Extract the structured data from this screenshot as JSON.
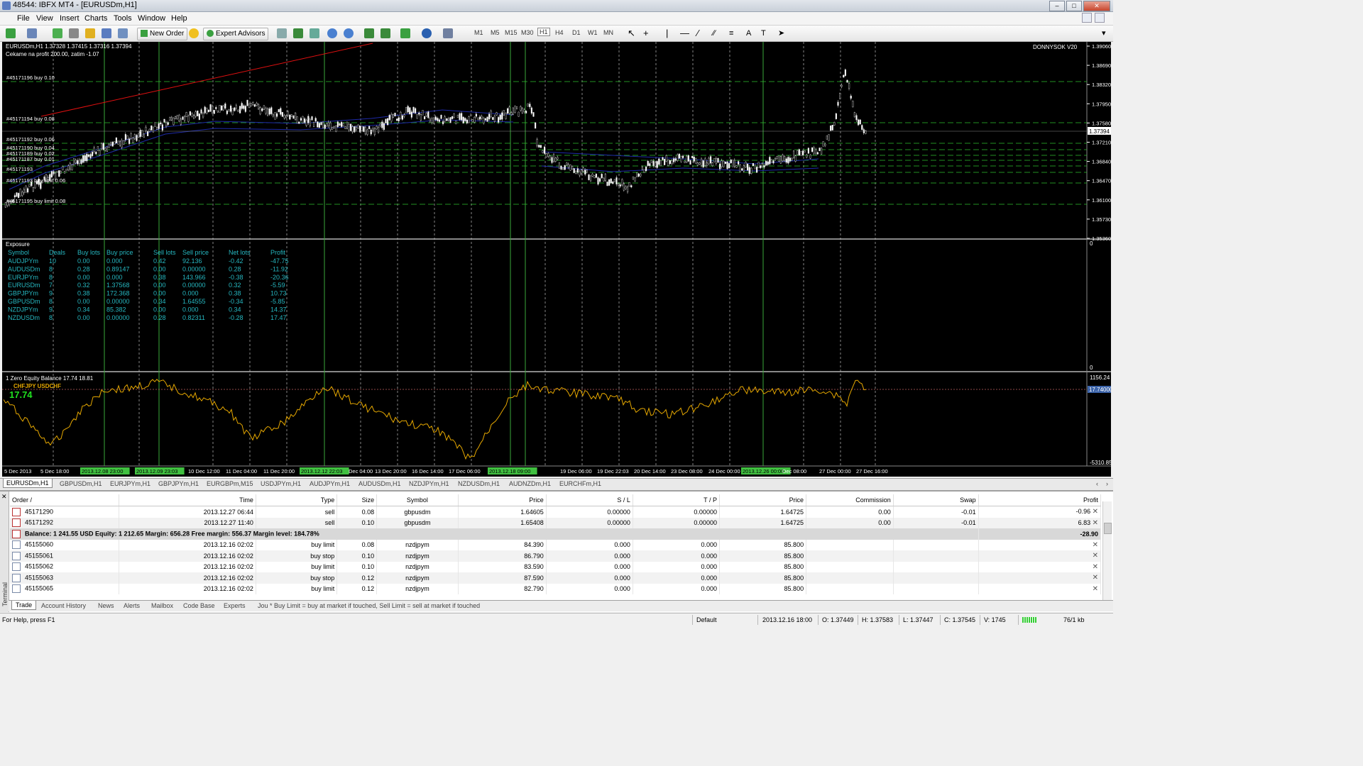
{
  "window": {
    "title": "48544: IBFX MT4 - [EURUSDm,H1]"
  },
  "menu": [
    "File",
    "View",
    "Insert",
    "Charts",
    "Tools",
    "Window",
    "Help"
  ],
  "toolbar": {
    "new_order": "New Order",
    "expert_advisors": "Expert Advisors",
    "timeframes": [
      "M1",
      "M5",
      "M15",
      "M30",
      "H1",
      "H4",
      "D1",
      "W1",
      "MN"
    ]
  },
  "chart": {
    "header_line1": "EURUSDm,H1 1.37328 1.37415 1.37316 1.37394",
    "header_line2": "Cekame na profit 200.00, zatim -1.07",
    "watermark": "DONNYSOK V20",
    "current_price": "1.37394",
    "price_labels": [
      "1.39060",
      "1.38690",
      "1.38320",
      "1.37950",
      "1.37580",
      "1.37210",
      "1.36840",
      "1.36470",
      "1.36100",
      "1.35730",
      "1.35360"
    ],
    "order_lines": [
      "#45171196 buy 0.10",
      "#45171194 buy 0.08",
      "#45171192 buy 0.06",
      "#45171190 buy 0.04",
      "#45171189 buy 0.02",
      "#45171187 buy 0.01",
      "#45171193",
      "#45171191 buy limit 0.06",
      "#45171195 buy limit 0.08"
    ],
    "order_lines_tail": [
      "0.02",
      "0.02"
    ],
    "order_id_partial": [
      "#45171193 buy limit 0.06",
      "#45171195 buy limit 0.08"
    ],
    "exposure": {
      "title": "Exposure",
      "headers": [
        "Symbol",
        "Deals",
        "Buy lots",
        "Buy price",
        "Sell lots",
        "Sell price",
        "Net lots",
        "Profit"
      ],
      "rows": [
        [
          "AUDJPYm",
          "10",
          "0.00",
          "0.000",
          "0.42",
          "92.136",
          "-0.42",
          "-47.75"
        ],
        [
          "AUDUSDm",
          "8",
          "0.28",
          "0.89147",
          "0.00",
          "0.00000",
          "0.28",
          "-11.92"
        ],
        [
          "EURJPYm",
          "8",
          "0.00",
          "0.000",
          "0.38",
          "143.966",
          "-0.38",
          "-20.36"
        ],
        [
          "EURUSDm",
          "7",
          "0.32",
          "1.37568",
          "0.00",
          "0.00000",
          "0.32",
          "-5.59"
        ],
        [
          "GBPJPYm",
          "9",
          "0.38",
          "172.368",
          "0.00",
          "0.000",
          "0.38",
          "10.73"
        ],
        [
          "GBPUSDm",
          "8",
          "0.00",
          "0.00000",
          "0.34",
          "1.64555",
          "-0.34",
          "-5.85"
        ],
        [
          "NZDJPYm",
          "9",
          "0.34",
          "85.382",
          "0.00",
          "0.000",
          "0.34",
          "14.37"
        ],
        [
          "NZDUSDm",
          "8",
          "0.00",
          "0.00000",
          "0.28",
          "0.82311",
          "-0.28",
          "17.47"
        ]
      ],
      "scale_top": "0",
      "scale_bottom": "0"
    },
    "equity": {
      "title": "1 Zero Equity Balance 17.74 18.81",
      "pairs": "CHFJPY USDCHF",
      "value": "17.74",
      "scale_top": "1156.24",
      "scale_current": "17.74000",
      "scale_bottom": "-5310.85"
    },
    "time_labels": [
      "5 Dec 2013",
      "5 Dec 18:00",
      "2013.12.08 23:00",
      "2013.12.09 23:03",
      "10 Dec 12:00",
      "11 Dec 04:00",
      "11 Dec 20:00",
      "2013.12.12 22:03",
      "Dec 04:00",
      "13 Dec 20:00",
      "16 Dec 14:00",
      "17 Dec 06:00",
      "2013.12.18 09:00",
      "19 Dec 06:00",
      "19 Dec 22:03",
      "20 Dec 14:00",
      "23 Dec 08:00",
      "24 Dec 00:00",
      "2013.12.26 00:00",
      "Dec 08:00",
      "27 Dec 00:00",
      "27 Dec 16:00"
    ]
  },
  "symbol_tabs": [
    "EURUSDm,H1",
    "GBPUSDm,H1",
    "EURJPYm,H1",
    "GBPJPYm,H1",
    "EURGBPm,M15",
    "USDJPYm,H1",
    "AUDJPYm,H1",
    "AUDUSDm,H1",
    "NZDJPYm,H1",
    "NZDUSDm,H1",
    "AUDNZDm,H1",
    "EURCHFm,H1"
  ],
  "terminal": {
    "side_label": "Terminal",
    "headers": [
      "Order",
      "Time",
      "Type",
      "Size",
      "Symbol",
      "Price",
      "S / L",
      "T / P",
      "Price",
      "Commission",
      "Swap",
      "Profit"
    ],
    "rows": [
      [
        "45171290",
        "2013.12.27 06:44",
        "sell",
        "0.08",
        "gbpusdm",
        "1.64605",
        "0.00000",
        "0.00000",
        "1.64725",
        "0.00",
        "-0.01",
        "-0.96"
      ],
      [
        "45171292",
        "2013.12.27 11:40",
        "sell",
        "0.10",
        "gbpusdm",
        "1.65408",
        "0.00000",
        "0.00000",
        "1.64725",
        "0.00",
        "-0.01",
        "6.83"
      ]
    ],
    "balance_line": "Balance: 1 241.55 USD  Equity: 1 212.65  Margin: 656.28  Free margin: 556.37  Margin level: 184.78%",
    "balance_profit": "-28.90",
    "pending": [
      [
        "45155060",
        "2013.12.16 02:02",
        "buy limit",
        "0.08",
        "nzdjpym",
        "84.390",
        "0.000",
        "0.000",
        "85.800"
      ],
      [
        "45155061",
        "2013.12.16 02:02",
        "buy stop",
        "0.10",
        "nzdjpym",
        "86.790",
        "0.000",
        "0.000",
        "85.800"
      ],
      [
        "45155062",
        "2013.12.16 02:02",
        "buy limit",
        "0.10",
        "nzdjpym",
        "83.590",
        "0.000",
        "0.000",
        "85.800"
      ],
      [
        "45155063",
        "2013.12.16 02:02",
        "buy stop",
        "0.12",
        "nzdjpym",
        "87.590",
        "0.000",
        "0.000",
        "85.800"
      ],
      [
        "45155065",
        "2013.12.16 02:02",
        "buy limit",
        "0.12",
        "nzdjpym",
        "82.790",
        "0.000",
        "0.000",
        "85.800"
      ]
    ],
    "bottom_tabs": [
      "Trade",
      "Account History",
      "News",
      "Alerts",
      "Mailbox",
      "Code Base",
      "Experts",
      "Jou"
    ],
    "hint": "* Buy Limit = buy at market if touched, Sell Limit = sell at market if touched"
  },
  "status": {
    "help": "For Help, press F1",
    "profile": "Default",
    "time": "2013.12.16 18:00",
    "open": "O: 1.37449",
    "high": "H: 1.37583",
    "low": "L: 1.37447",
    "close": "C: 1.37545",
    "volume": "V: 1745",
    "traffic": "76/1 kb"
  },
  "colors": {
    "bull": "#ffffff",
    "bear": "#000000",
    "grid_green": "#00c000",
    "equity": "#e6a800",
    "cyan_text": "#26b7c0",
    "trend_red": "#e01010"
  }
}
